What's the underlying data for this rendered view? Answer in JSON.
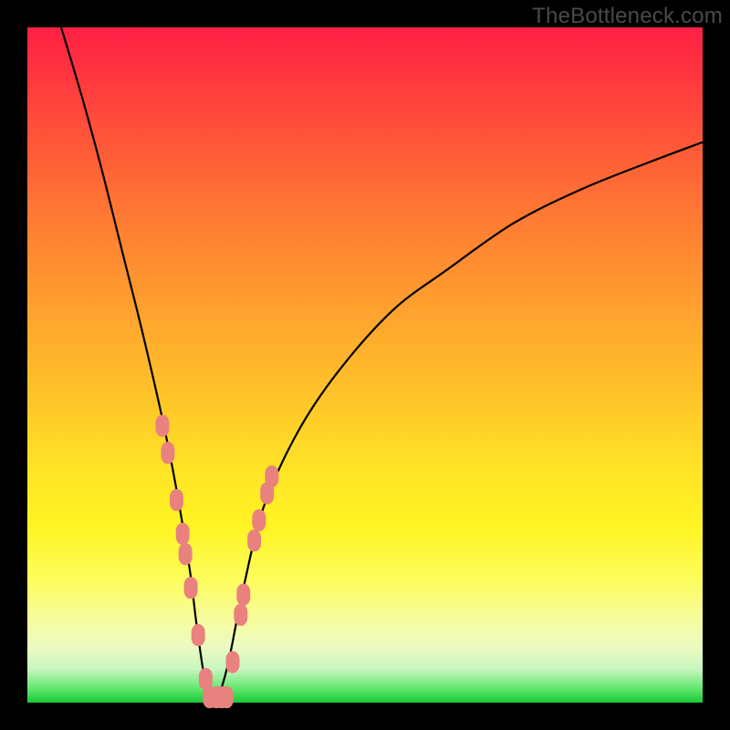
{
  "watermark": "TheBottleneck.com",
  "colors": {
    "frame": "#000000",
    "curve_stroke": "#000000",
    "marker_fill": "#e9817f",
    "marker_stroke": "#c96a68"
  },
  "chart_data": {
    "type": "line",
    "title": "",
    "xlabel": "",
    "ylabel": "",
    "xlim": [
      0,
      100
    ],
    "ylim": [
      0,
      100
    ],
    "grid": false,
    "legend": false,
    "note": "V-shaped bottleneck curve; minimum (optimal) near x≈27 at y≈0. Left arm rises steeply to ~100 at x≈5; right arm rises more gradually to ~83 at x≈100. No axis ticks or numeric labels are visible; x/y are normalized 0–100 estimates from pixel positions.",
    "series": [
      {
        "name": "bottleneck-curve",
        "x": [
          5,
          8,
          11,
          14,
          17,
          20,
          22,
          24,
          25,
          26,
          27,
          28,
          29,
          30,
          32,
          35,
          40,
          46,
          54,
          62,
          72,
          82,
          92,
          100
        ],
        "y": [
          100,
          90,
          79,
          67,
          55,
          42,
          32,
          20,
          12,
          5,
          0,
          0,
          3,
          7,
          17,
          29,
          40,
          49,
          58,
          64,
          71,
          76,
          80,
          83
        ]
      }
    ],
    "markers": {
      "name": "highlighted-points",
      "note": "Pink lozenge markers clustered around the curve minimum on both arms.",
      "points": [
        {
          "x": 20.0,
          "y": 41.0
        },
        {
          "x": 20.8,
          "y": 37.0
        },
        {
          "x": 22.1,
          "y": 30.0
        },
        {
          "x": 23.0,
          "y": 25.0
        },
        {
          "x": 23.4,
          "y": 22.0
        },
        {
          "x": 24.2,
          "y": 17.0
        },
        {
          "x": 25.3,
          "y": 10.0
        },
        {
          "x": 26.4,
          "y": 3.5
        },
        {
          "x": 27.0,
          "y": 0.8
        },
        {
          "x": 28.0,
          "y": 0.8
        },
        {
          "x": 28.8,
          "y": 0.8
        },
        {
          "x": 29.5,
          "y": 0.8
        },
        {
          "x": 30.4,
          "y": 6.0
        },
        {
          "x": 31.6,
          "y": 13.0
        },
        {
          "x": 32.0,
          "y": 16.0
        },
        {
          "x": 33.6,
          "y": 24.0
        },
        {
          "x": 34.3,
          "y": 27.0
        },
        {
          "x": 35.5,
          "y": 31.0
        },
        {
          "x": 36.2,
          "y": 33.5
        }
      ]
    }
  }
}
